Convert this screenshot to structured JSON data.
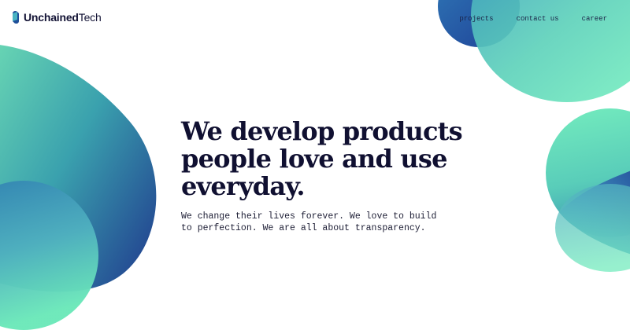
{
  "header": {
    "brand_strong": "Unchained",
    "brand_light": "Tech",
    "nav": [
      {
        "label": "projects"
      },
      {
        "label": "contact us"
      },
      {
        "label": "career"
      }
    ]
  },
  "hero": {
    "title": "We develop products people love and use everyday.",
    "subtitle": "We change their lives forever. We love to build to perfection. We are all about transparency."
  },
  "colors": {
    "navy": "#101031",
    "blue": "#1f4f99",
    "teal": "#49b3c2",
    "mint": "#64e6b7"
  }
}
